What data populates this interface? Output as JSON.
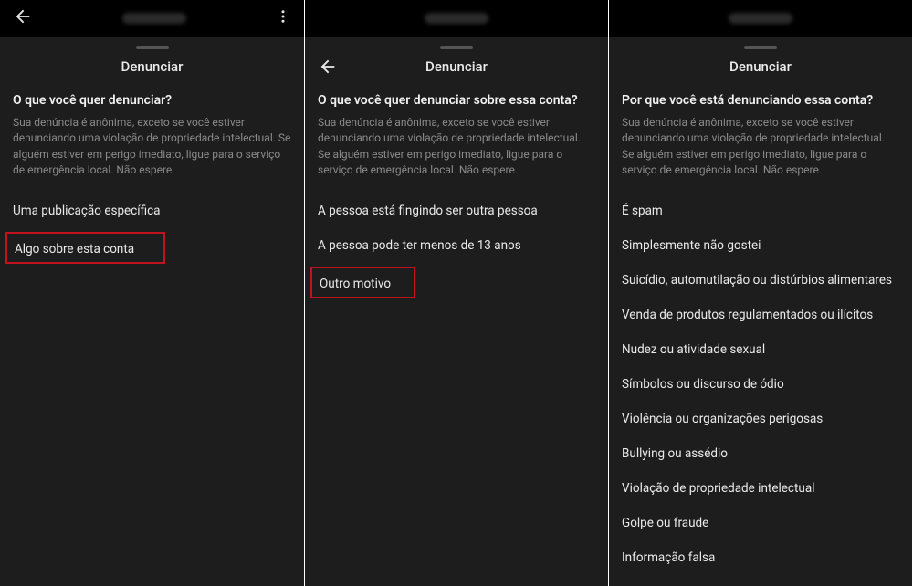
{
  "panels": [
    {
      "showSheetBack": false,
      "showTopbar": true,
      "title": "Denunciar",
      "question": "O que você quer denunciar?",
      "description": "Sua denúncia é anônima, exceto se você estiver denunciando uma violação de propriedade intelectual. Se alguém estiver em perigo imediato, ligue para o serviço de emergência local. Não espere.",
      "options": [
        {
          "label": "Uma publicação específica",
          "highlight": false
        },
        {
          "label": "Algo sobre esta conta",
          "highlight": true
        }
      ]
    },
    {
      "showSheetBack": true,
      "showTopbar": false,
      "title": "Denunciar",
      "question": "O que você quer denunciar sobre essa conta?",
      "description": "Sua denúncia é anônima, exceto se você estiver denunciando uma violação de propriedade intelectual. Se alguém estiver em perigo imediato, ligue para o serviço de emergência local. Não espere.",
      "options": [
        {
          "label": "A pessoa está fingindo ser outra pessoa",
          "highlight": false
        },
        {
          "label": "A pessoa pode ter menos de 13 anos",
          "highlight": false
        },
        {
          "label": "Outro motivo",
          "highlight": true
        }
      ]
    },
    {
      "showSheetBack": false,
      "showTopbar": false,
      "title": "Denunciar",
      "question": "Por que você está denunciando essa conta?",
      "description": "Sua denúncia é anônima, exceto se você estiver denunciando uma violação de propriedade intelectual. Se alguém estiver em perigo imediato, ligue para o serviço de emergência local. Não espere.",
      "options": [
        {
          "label": "É spam",
          "highlight": false
        },
        {
          "label": "Simplesmente não gostei",
          "highlight": false
        },
        {
          "label": "Suicídio, automutilação ou distúrbios alimentares",
          "highlight": false
        },
        {
          "label": "Venda de produtos regulamentados ou ilícitos",
          "highlight": false
        },
        {
          "label": "Nudez ou atividade sexual",
          "highlight": false
        },
        {
          "label": "Símbolos ou discurso de ódio",
          "highlight": false
        },
        {
          "label": "Violência ou organizações perigosas",
          "highlight": false
        },
        {
          "label": "Bullying ou assédio",
          "highlight": false
        },
        {
          "label": "Violação de propriedade intelectual",
          "highlight": false
        },
        {
          "label": "Golpe ou fraude",
          "highlight": false
        },
        {
          "label": "Informação falsa",
          "highlight": false
        }
      ]
    }
  ]
}
